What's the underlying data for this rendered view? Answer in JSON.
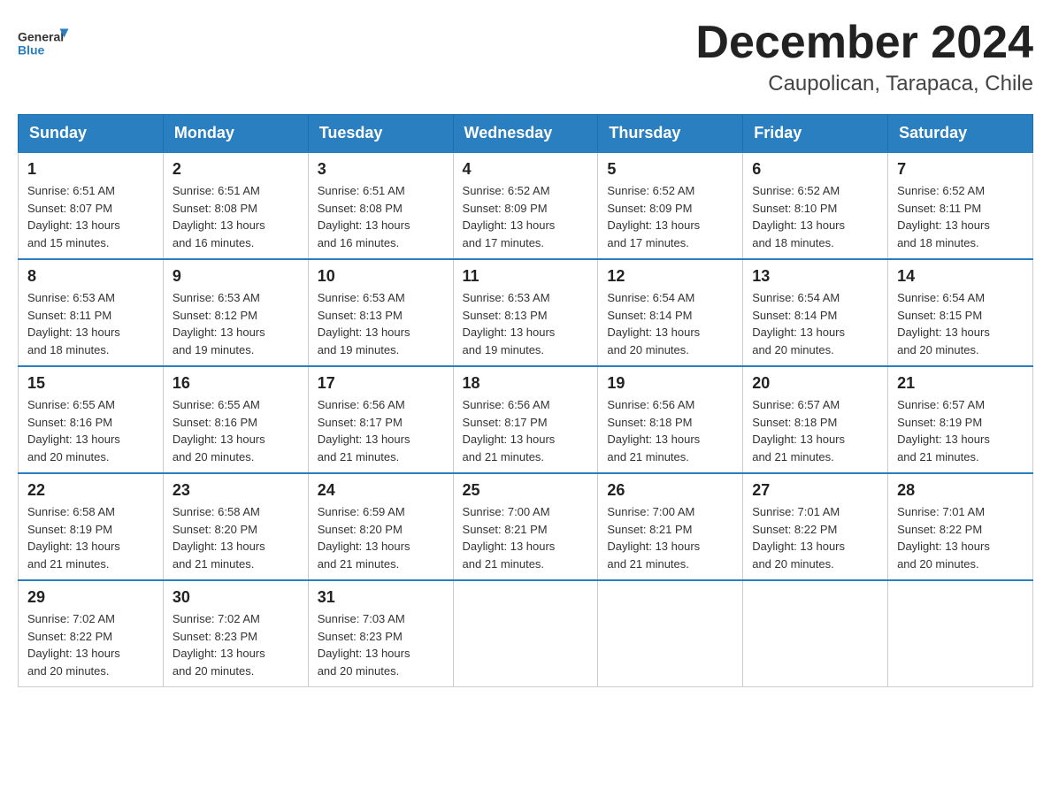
{
  "header": {
    "logo_general": "General",
    "logo_blue": "Blue",
    "month_title": "December 2024",
    "location": "Caupolican, Tarapaca, Chile"
  },
  "weekdays": [
    "Sunday",
    "Monday",
    "Tuesday",
    "Wednesday",
    "Thursday",
    "Friday",
    "Saturday"
  ],
  "weeks": [
    [
      {
        "day": "1",
        "sunrise": "6:51 AM",
        "sunset": "8:07 PM",
        "daylight": "13 hours and 15 minutes."
      },
      {
        "day": "2",
        "sunrise": "6:51 AM",
        "sunset": "8:08 PM",
        "daylight": "13 hours and 16 minutes."
      },
      {
        "day": "3",
        "sunrise": "6:51 AM",
        "sunset": "8:08 PM",
        "daylight": "13 hours and 16 minutes."
      },
      {
        "day": "4",
        "sunrise": "6:52 AM",
        "sunset": "8:09 PM",
        "daylight": "13 hours and 17 minutes."
      },
      {
        "day": "5",
        "sunrise": "6:52 AM",
        "sunset": "8:09 PM",
        "daylight": "13 hours and 17 minutes."
      },
      {
        "day": "6",
        "sunrise": "6:52 AM",
        "sunset": "8:10 PM",
        "daylight": "13 hours and 18 minutes."
      },
      {
        "day": "7",
        "sunrise": "6:52 AM",
        "sunset": "8:11 PM",
        "daylight": "13 hours and 18 minutes."
      }
    ],
    [
      {
        "day": "8",
        "sunrise": "6:53 AM",
        "sunset": "8:11 PM",
        "daylight": "13 hours and 18 minutes."
      },
      {
        "day": "9",
        "sunrise": "6:53 AM",
        "sunset": "8:12 PM",
        "daylight": "13 hours and 19 minutes."
      },
      {
        "day": "10",
        "sunrise": "6:53 AM",
        "sunset": "8:13 PM",
        "daylight": "13 hours and 19 minutes."
      },
      {
        "day": "11",
        "sunrise": "6:53 AM",
        "sunset": "8:13 PM",
        "daylight": "13 hours and 19 minutes."
      },
      {
        "day": "12",
        "sunrise": "6:54 AM",
        "sunset": "8:14 PM",
        "daylight": "13 hours and 20 minutes."
      },
      {
        "day": "13",
        "sunrise": "6:54 AM",
        "sunset": "8:14 PM",
        "daylight": "13 hours and 20 minutes."
      },
      {
        "day": "14",
        "sunrise": "6:54 AM",
        "sunset": "8:15 PM",
        "daylight": "13 hours and 20 minutes."
      }
    ],
    [
      {
        "day": "15",
        "sunrise": "6:55 AM",
        "sunset": "8:16 PM",
        "daylight": "13 hours and 20 minutes."
      },
      {
        "day": "16",
        "sunrise": "6:55 AM",
        "sunset": "8:16 PM",
        "daylight": "13 hours and 20 minutes."
      },
      {
        "day": "17",
        "sunrise": "6:56 AM",
        "sunset": "8:17 PM",
        "daylight": "13 hours and 21 minutes."
      },
      {
        "day": "18",
        "sunrise": "6:56 AM",
        "sunset": "8:17 PM",
        "daylight": "13 hours and 21 minutes."
      },
      {
        "day": "19",
        "sunrise": "6:56 AM",
        "sunset": "8:18 PM",
        "daylight": "13 hours and 21 minutes."
      },
      {
        "day": "20",
        "sunrise": "6:57 AM",
        "sunset": "8:18 PM",
        "daylight": "13 hours and 21 minutes."
      },
      {
        "day": "21",
        "sunrise": "6:57 AM",
        "sunset": "8:19 PM",
        "daylight": "13 hours and 21 minutes."
      }
    ],
    [
      {
        "day": "22",
        "sunrise": "6:58 AM",
        "sunset": "8:19 PM",
        "daylight": "13 hours and 21 minutes."
      },
      {
        "day": "23",
        "sunrise": "6:58 AM",
        "sunset": "8:20 PM",
        "daylight": "13 hours and 21 minutes."
      },
      {
        "day": "24",
        "sunrise": "6:59 AM",
        "sunset": "8:20 PM",
        "daylight": "13 hours and 21 minutes."
      },
      {
        "day": "25",
        "sunrise": "7:00 AM",
        "sunset": "8:21 PM",
        "daylight": "13 hours and 21 minutes."
      },
      {
        "day": "26",
        "sunrise": "7:00 AM",
        "sunset": "8:21 PM",
        "daylight": "13 hours and 21 minutes."
      },
      {
        "day": "27",
        "sunrise": "7:01 AM",
        "sunset": "8:22 PM",
        "daylight": "13 hours and 20 minutes."
      },
      {
        "day": "28",
        "sunrise": "7:01 AM",
        "sunset": "8:22 PM",
        "daylight": "13 hours and 20 minutes."
      }
    ],
    [
      {
        "day": "29",
        "sunrise": "7:02 AM",
        "sunset": "8:22 PM",
        "daylight": "13 hours and 20 minutes."
      },
      {
        "day": "30",
        "sunrise": "7:02 AM",
        "sunset": "8:23 PM",
        "daylight": "13 hours and 20 minutes."
      },
      {
        "day": "31",
        "sunrise": "7:03 AM",
        "sunset": "8:23 PM",
        "daylight": "13 hours and 20 minutes."
      },
      null,
      null,
      null,
      null
    ]
  ],
  "labels": {
    "sunrise": "Sunrise:",
    "sunset": "Sunset:",
    "daylight": "Daylight:"
  }
}
